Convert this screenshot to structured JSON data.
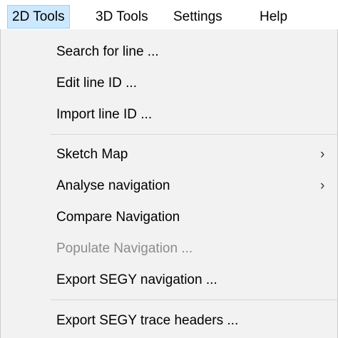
{
  "menubar": {
    "items": [
      {
        "label": "2D Tools"
      },
      {
        "label": "3D Tools"
      },
      {
        "label": "Settings"
      },
      {
        "label": "Help"
      }
    ],
    "active_index": 0
  },
  "dropdown": {
    "groups": [
      {
        "items": [
          {
            "label": "Search for line ...",
            "enabled": true,
            "submenu": false
          },
          {
            "label": "Edit line ID ...",
            "enabled": true,
            "submenu": false
          },
          {
            "label": "Import line ID ...",
            "enabled": true,
            "submenu": false
          }
        ]
      },
      {
        "items": [
          {
            "label": "Sketch Map",
            "enabled": true,
            "submenu": true
          },
          {
            "label": "Analyse navigation",
            "enabled": true,
            "submenu": true
          },
          {
            "label": "Compare Navigation",
            "enabled": true,
            "submenu": false
          },
          {
            "label": "Populate Navigation ...",
            "enabled": false,
            "submenu": false
          },
          {
            "label": "Export SEGY navigation ...",
            "enabled": true,
            "submenu": false
          }
        ]
      },
      {
        "items": [
          {
            "label": "Export SEGY trace headers ...",
            "enabled": true,
            "submenu": false
          }
        ]
      }
    ],
    "submenu_glyph": "›"
  },
  "colors": {
    "menubar_bg": "#ffffff",
    "active_highlight": "#cce8ff",
    "active_border": "#99d1ff",
    "dropdown_bg": "#f2f2f2",
    "disabled_text": "#8c8c8c",
    "separator": "#d7d7d7"
  },
  "icons": {
    "submenu": "chevron-right-icon"
  }
}
